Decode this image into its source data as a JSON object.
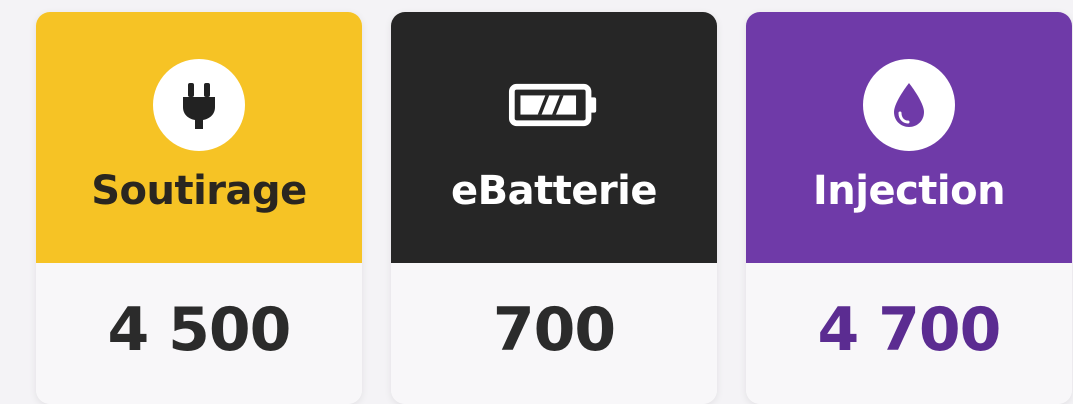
{
  "cards": [
    {
      "label": "Soutirage",
      "value": "4 500",
      "icon": "plug-icon",
      "colors": {
        "top": "#f6c325",
        "label": "#2a2620",
        "value": "#2b2b2b"
      }
    },
    {
      "label": "eBatterie",
      "value": "700",
      "icon": "battery-icon",
      "colors": {
        "top": "#262626",
        "label": "#ffffff",
        "value": "#2b2b2b"
      }
    },
    {
      "label": "Injection",
      "value": "4 700",
      "icon": "droplet-icon",
      "colors": {
        "top": "#6f3aa8",
        "label": "#ffffff",
        "value": "#5b2c91"
      }
    }
  ]
}
